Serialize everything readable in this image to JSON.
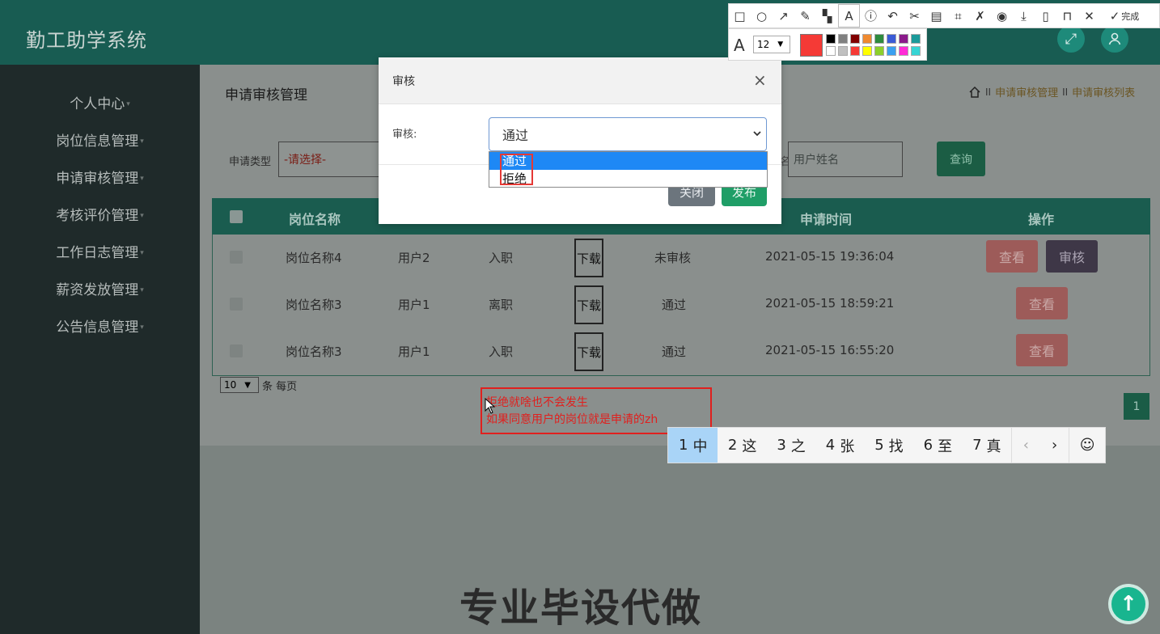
{
  "app": {
    "title": "勤工助学系统"
  },
  "header": {
    "fullscreen_icon": "expand-icon",
    "user_icon": "user-icon"
  },
  "sidebar": {
    "items": [
      {
        "label": "个人中心"
      },
      {
        "label": "岗位信息管理"
      },
      {
        "label": "申请审核管理"
      },
      {
        "label": "考核评价管理"
      },
      {
        "label": "工作日志管理"
      },
      {
        "label": "薪资发放管理"
      },
      {
        "label": "公告信息管理"
      }
    ]
  },
  "page": {
    "heading": "申请审核管理",
    "breadcrumb": [
      "申请审核管理",
      "申请审核列表"
    ]
  },
  "filters": {
    "type_label": "申请类型",
    "type_value": "-请选择-",
    "name_label_fragment": "名",
    "name_placeholder": "用户姓名",
    "query_label": "查询"
  },
  "table": {
    "headers": [
      "岗位名称",
      "申请时间",
      "操作"
    ],
    "rows": [
      {
        "job": "岗位名称4",
        "user": "用户2",
        "type": "入职",
        "file": "下载",
        "status": "未审核",
        "time": "2021-05-15 19:36:04",
        "view": "查看",
        "review": "审核"
      },
      {
        "job": "岗位名称3",
        "user": "用户1",
        "type": "离职",
        "file": "下载",
        "status": "通过",
        "time": "2021-05-15 18:59:21",
        "view": "查看"
      },
      {
        "job": "岗位名称3",
        "user": "用户1",
        "type": "入职",
        "file": "下载",
        "status": "通过",
        "time": "2021-05-15 16:55:20",
        "view": "查看"
      }
    ]
  },
  "pagination": {
    "page_size": "10",
    "per_page_label": "条 每页",
    "current_page": "1"
  },
  "dialog": {
    "title": "审核",
    "close_symbol": "×",
    "field_label": "审核:",
    "selected": "通过",
    "options": [
      "通过",
      "拒绝"
    ],
    "close_button": "关闭",
    "publish_button": "发布"
  },
  "annotation": {
    "line1": "拒绝就啥也不会发生",
    "line2": "如果同意用户的岗位就是申请的zh"
  },
  "ime": {
    "candidates": [
      {
        "n": "1",
        "c": "中"
      },
      {
        "n": "2",
        "c": "这"
      },
      {
        "n": "3",
        "c": "之"
      },
      {
        "n": "4",
        "c": "张"
      },
      {
        "n": "5",
        "c": "找"
      },
      {
        "n": "6",
        "c": "至"
      },
      {
        "n": "7",
        "c": "真"
      }
    ],
    "prev": "‹",
    "next": "›",
    "emoji": "☺"
  },
  "screenshot_tool": {
    "done_label": "完成",
    "font_size": "12",
    "active_color": "#f53a36",
    "palette": [
      "#000000",
      "#808080",
      "#800000",
      "#f08a30",
      "#2e8b3e",
      "#3b5bd6",
      "#8b1b8b",
      "#1b9a9a",
      "#ffffff",
      "#c0c0c0",
      "#f53a36",
      "#ffff00",
      "#8ccf2c",
      "#3aa0f0",
      "#ff2bd6",
      "#36d4d4"
    ]
  },
  "watermark": "专业毕设代做",
  "scroll_top_icon": "arrow-up-icon"
}
